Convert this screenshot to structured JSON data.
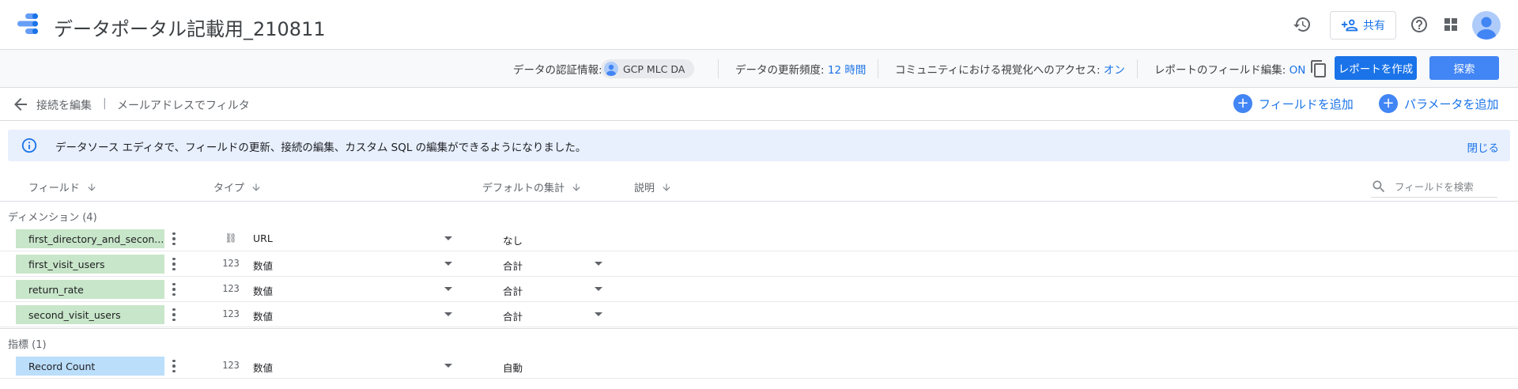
{
  "app": {
    "title": "データポータル記載用_210811",
    "share_label": "共有",
    "icons": [
      "history-icon",
      "help-icon",
      "apps-grid-icon"
    ]
  },
  "infobar": {
    "credentials_label": "データの認証情報:",
    "credentials_value": "GCP MLC DA",
    "freshness_label": "データの更新頻度:",
    "freshness_value": "12 時間",
    "community_label": "コミュニティにおける視覚化へのアクセス:",
    "community_value": "オン",
    "field_edit_label": "レポートのフィールド編集:",
    "field_edit_value": "ON",
    "create_report": "レポートを作成",
    "explore": "探索"
  },
  "subbar": {
    "edit_connection": "接続を編集",
    "separator": "|",
    "filter_by_email": "メールアドレスでフィルタ",
    "add_field": "フィールドを追加",
    "add_parameter": "パラメータを追加"
  },
  "banner": {
    "text": "データソース エディタで、フィールドの更新、接続の編集、カスタム SQL の編集ができるようになりました。",
    "close": "閉じる"
  },
  "columns": {
    "field": "フィールド",
    "type": "タイプ",
    "default_agg": "デフォルトの集計",
    "description": "説明",
    "search_placeholder": "フィールドを検索"
  },
  "dimensions": {
    "label": "ディメンション (4)",
    "rows": [
      {
        "name": "first_directory_and_secon...",
        "type_icon": "⛓",
        "type": "URL",
        "agg": "なし",
        "agg_dropdown": false
      },
      {
        "name": "first_visit_users",
        "type_icon": "123",
        "type": "数値",
        "agg": "合計",
        "agg_dropdown": true
      },
      {
        "name": "return_rate",
        "type_icon": "123",
        "type": "数値",
        "agg": "合計",
        "agg_dropdown": true
      },
      {
        "name": "second_visit_users",
        "type_icon": "123",
        "type": "数値",
        "agg": "合計",
        "agg_dropdown": true
      }
    ]
  },
  "metrics": {
    "label": "指標 (1)",
    "rows": [
      {
        "name": "Record Count",
        "type_icon": "123",
        "type": "数値",
        "agg": "自動",
        "agg_dropdown": false
      }
    ]
  }
}
